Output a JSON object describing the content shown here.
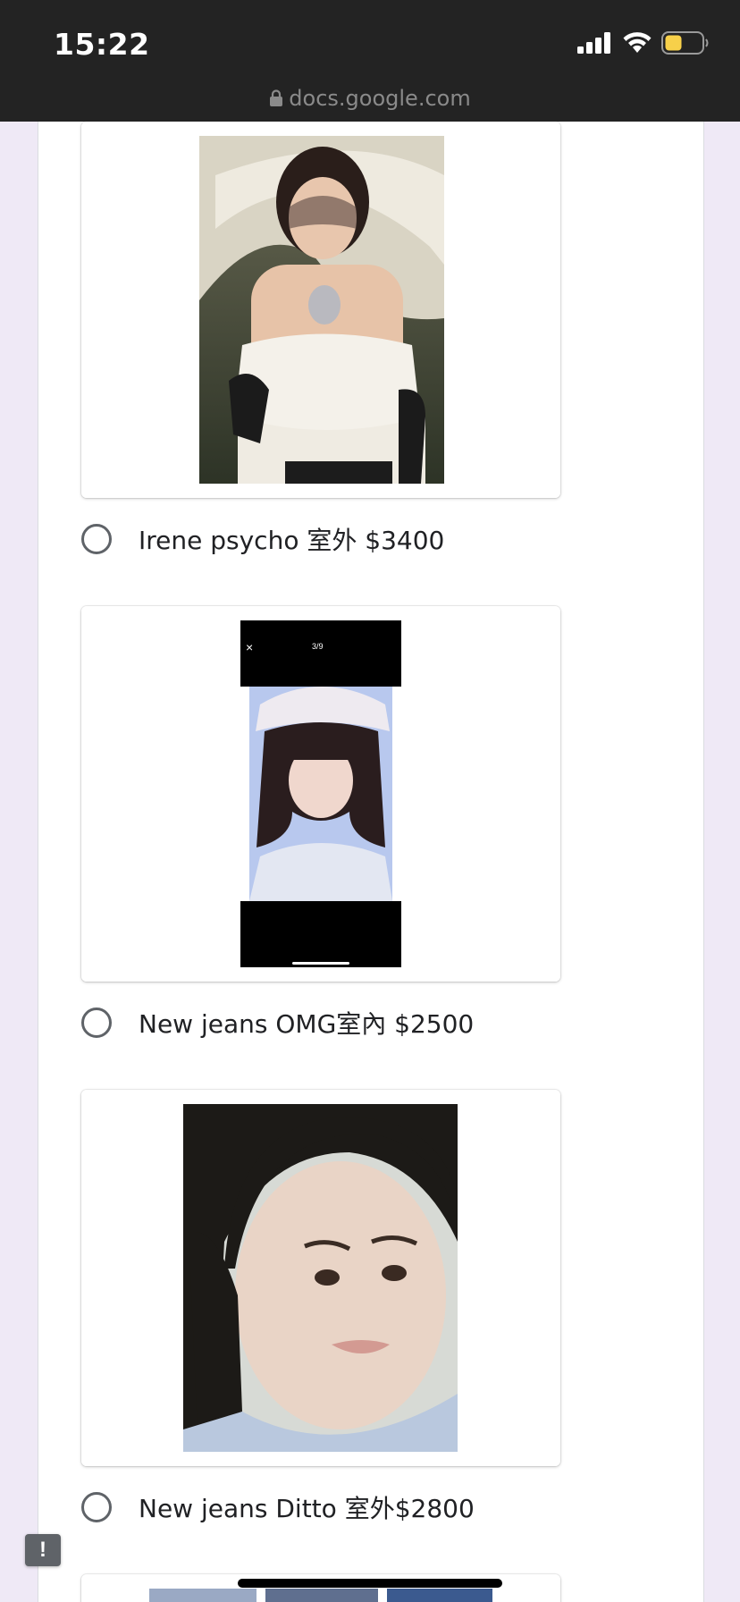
{
  "status_bar": {
    "time": "15:22",
    "url": "docs.google.com"
  },
  "options": [
    {
      "label": "Irene psycho 室外 $3400"
    },
    {
      "label": "New jeans OMG室內 $2500"
    },
    {
      "label": "New jeans Ditto 室外$2800"
    }
  ],
  "screenshot_overlay": {
    "close": "×",
    "counter": "3/9"
  },
  "colors": {
    "page_background": "#efe9f6",
    "status_bar": "#232323",
    "battery_fill": "#f7d04a",
    "radio_border": "#5f6368"
  },
  "icons": [
    "lock-icon",
    "signal-icon",
    "wifi-icon",
    "battery-icon",
    "feedback-icon"
  ]
}
